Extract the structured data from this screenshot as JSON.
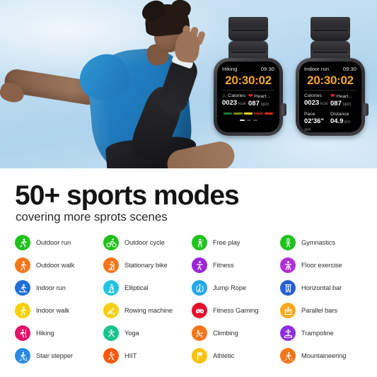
{
  "hero": {
    "alt": "athlete running outdoors against blue sky"
  },
  "watches": [
    {
      "id": "watch-hiking",
      "activity": "Hiking",
      "time": "09:30",
      "timer": "20:30:02",
      "metrics": [
        {
          "icon": "flame-icon",
          "label": "Calories",
          "value": "0023",
          "unit": "kcal"
        },
        {
          "icon": "heart-icon",
          "label": "Heart...",
          "value": "087",
          "unit": "bpm"
        }
      ],
      "zone_bar": [
        "#1f7a2e",
        "#7d8a17",
        "#f3d11a",
        "#8e1f16",
        "#d1291f"
      ],
      "page_dots": 3,
      "active_dot": 0
    },
    {
      "id": "watch-indoor-run",
      "activity": "Indoor run",
      "time": "09:30",
      "timer": "20:30:02",
      "metrics": [
        {
          "icon": "none",
          "label": "Calories",
          "value": "0023",
          "unit": "kcal"
        },
        {
          "icon": "heart-icon",
          "label": "Heart...",
          "value": "087",
          "unit": "bpm"
        },
        {
          "icon": "none",
          "label": "Pace",
          "value": "02'36\"",
          "unit": "/km"
        },
        {
          "icon": "none",
          "label": "Distance",
          "value": "04.9",
          "unit": "km"
        }
      ]
    }
  ],
  "headline": "50+ sports modes",
  "subhead": "covering more sprots scenes",
  "sports_modes": [
    {
      "label": "Outdoor run",
      "color": "#22c11e",
      "icon": "running-icon"
    },
    {
      "label": "Outdoor cycle",
      "color": "#22c11e",
      "icon": "cycling-icon"
    },
    {
      "label": "Free play",
      "color": "#22c11e",
      "icon": "free-play-icon"
    },
    {
      "label": "Gymnastics",
      "color": "#22c11e",
      "icon": "gymnastics-icon"
    },
    {
      "label": "Outdoor walk",
      "color": "#f4761b",
      "icon": "walking-icon"
    },
    {
      "label": "Stationary bike",
      "color": "#f4761b",
      "icon": "stationary-bike-icon"
    },
    {
      "label": "Fitness",
      "color": "#9b27d6",
      "icon": "fitness-icon"
    },
    {
      "label": "Floor exercise",
      "color": "#b02fd6",
      "icon": "floor-exercise-icon"
    },
    {
      "label": "Indoor run",
      "color": "#1f6fd6",
      "icon": "treadmill-icon"
    },
    {
      "label": "Elliptical",
      "color": "#22c3e0",
      "icon": "elliptical-icon"
    },
    {
      "label": "Jump Rope",
      "color": "#22a7e8",
      "icon": "jump-rope-icon"
    },
    {
      "label": "Horizontal bar",
      "color": "#2a5fd0",
      "icon": "horizontal-bar-icon"
    },
    {
      "label": "Indoor walk",
      "color": "#f7d108",
      "icon": "indoor-walk-icon"
    },
    {
      "label": "Rowing machine",
      "color": "#f5cf12",
      "icon": "rowing-icon"
    },
    {
      "label": "Fitness Gaming",
      "color": "#e60f2e",
      "icon": "gamepad-icon"
    },
    {
      "label": "Parallel bars",
      "color": "#f9a91b",
      "icon": "parallel-bars-icon"
    },
    {
      "label": "Hiking",
      "color": "#e4106a",
      "icon": "hiking-icon"
    },
    {
      "label": "Yoga",
      "color": "#14c48c",
      "icon": "yoga-icon"
    },
    {
      "label": "Climbing",
      "color": "#f4761b",
      "icon": "climbing-icon"
    },
    {
      "label": "Trampoline",
      "color": "#8e30de",
      "icon": "trampoline-icon"
    },
    {
      "label": "Stair stepper",
      "color": "#2b8ae0",
      "icon": "stair-stepper-icon"
    },
    {
      "label": "HIIT",
      "color": "#f45a12",
      "icon": "hiit-icon"
    },
    {
      "label": "Athletic",
      "color": "#f9c215",
      "icon": "flag-icon"
    },
    {
      "label": "Mountaineering",
      "color": "#f4761b",
      "icon": "mountaineering-icon"
    }
  ]
}
